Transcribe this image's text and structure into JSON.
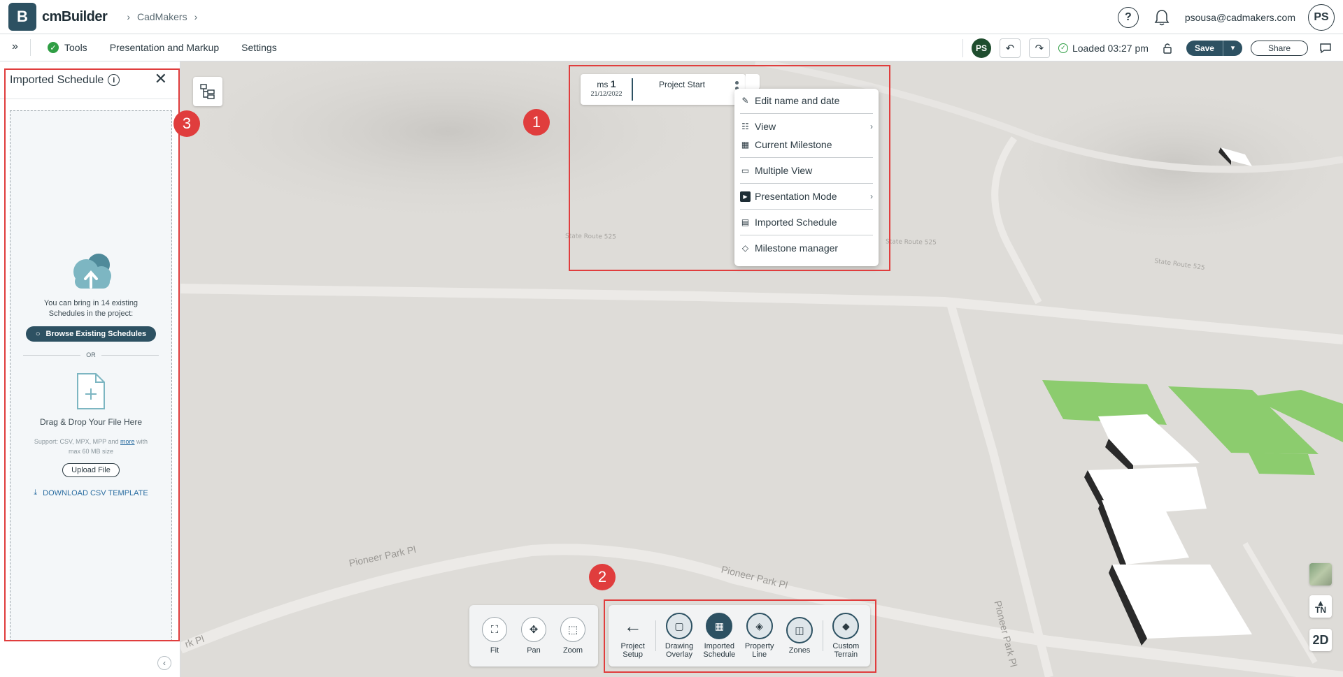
{
  "header": {
    "logo_letter": "B",
    "brand": "cmBuilder",
    "breadcrumb": [
      "CadMakers"
    ],
    "help_icon": "help-icon",
    "bell_icon": "bell-icon",
    "user_email": "psousa@cadmakers.com",
    "user_initials": "PS"
  },
  "toolbar": {
    "expand_icon": "»",
    "menu": [
      "Tools",
      "Presentation and Markup",
      "Settings"
    ],
    "collaborator_initials": "PS",
    "loaded_status": "Loaded 03:27 pm",
    "save_label": "Save",
    "share_label": "Share"
  },
  "imported_panel": {
    "title": "Imported Schedule",
    "info_icon": "i",
    "bring_text": "You can bring in 14 existing Schedules in the project:",
    "browse_label": "Browse Existing Schedules",
    "or_label": "OR",
    "drag_text": "Drag & Drop Your File Here",
    "support_text": "Support: CSV, MPX, MPP and",
    "support_link": "more",
    "support_suffix": "with max 60 MB size",
    "upload_label": "Upload File",
    "download_label": "DOWNLOAD CSV TEMPLATE"
  },
  "milestone": {
    "prefix": "ms",
    "number": "1",
    "date": "21/12/2022",
    "title": "Project Start"
  },
  "context_menu": [
    {
      "label": "Edit name and date",
      "icon": "pencil-icon",
      "submenu": false
    },
    {
      "label": "View",
      "icon": "grid-view-icon",
      "submenu": true
    },
    {
      "label": "Current Milestone",
      "icon": "calendar-icon",
      "submenu": false
    },
    {
      "label": "Multiple View",
      "icon": "multiple-view-icon",
      "submenu": false
    },
    {
      "label": "Presentation Mode",
      "icon": "play-icon",
      "submenu": true
    },
    {
      "label": "Imported Schedule",
      "icon": "schedule-icon",
      "submenu": false
    },
    {
      "label": "Milestone manager",
      "icon": "diamond-icon",
      "submenu": false
    }
  ],
  "nav_tools": [
    {
      "label": "Fit",
      "icon": "fit-icon"
    },
    {
      "label": "Pan",
      "icon": "pan-icon"
    },
    {
      "label": "Zoom",
      "icon": "zoom-icon"
    }
  ],
  "main_tools": {
    "back": {
      "line1": "Project",
      "line2": "Setup"
    },
    "items": [
      {
        "line1": "Drawing",
        "line2": "Overlay",
        "icon": "drawing-overlay-icon",
        "active": false
      },
      {
        "line1": "Imported",
        "line2": "Schedule",
        "icon": "imported-schedule-icon",
        "active": true
      },
      {
        "line1": "Property",
        "line2": "Line",
        "icon": "property-line-icon",
        "active": false
      },
      {
        "line1": "Zones",
        "line2": "",
        "icon": "zones-icon",
        "active": false
      }
    ],
    "custom": {
      "line1": "Custom",
      "line2": "Terrain",
      "icon": "custom-terrain-icon"
    }
  },
  "map_labels": {
    "state_route": "State Route 525",
    "pioneer_park_pl": "Pioneer Park Pl",
    "pioneer_park_pl_short": "rk Pl"
  },
  "map_controls": {
    "tn_label": "TN",
    "view_mode": "2D"
  },
  "annotations": [
    "1",
    "2",
    "3"
  ],
  "colors": {
    "brand": "#2d5162",
    "callout_red": "#e03d3d",
    "success": "#2f9e44",
    "zone_green": "#8ccc6e"
  }
}
